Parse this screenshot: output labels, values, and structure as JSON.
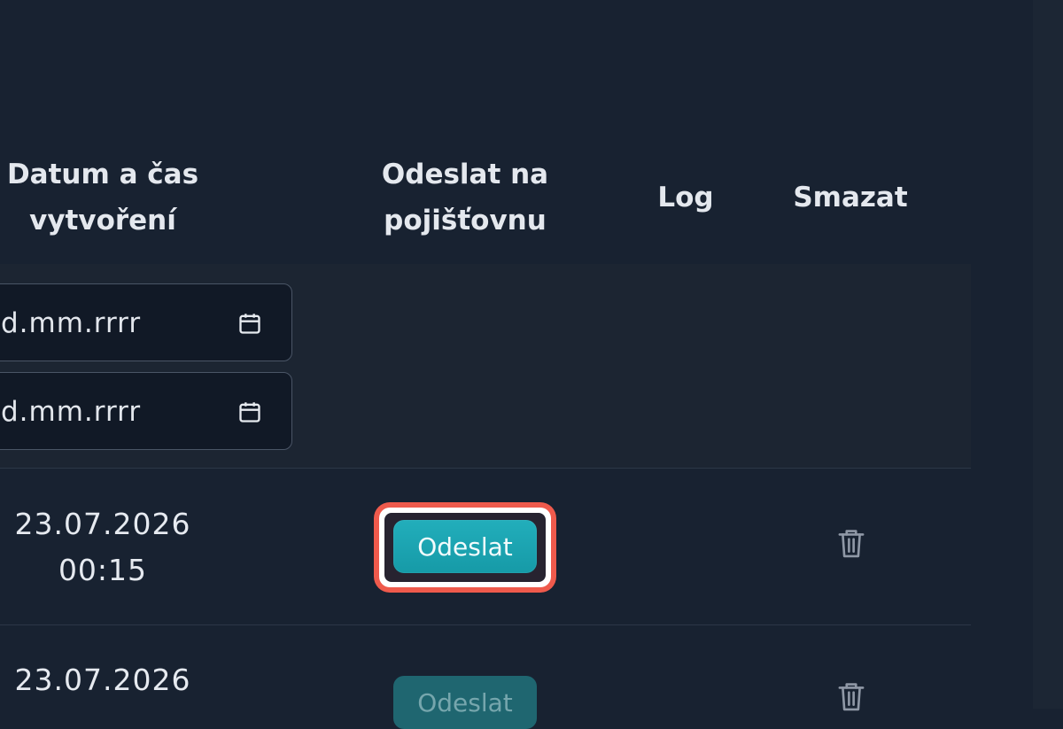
{
  "table": {
    "headers": {
      "date_created": "Datum a čas\nvytvoření",
      "send_to_insurer": "Odeslat na\npojišťovnu",
      "log": "Log",
      "delete": "Smazat"
    },
    "filters": {
      "date_from_placeholder": "d.mm.rrrr",
      "date_to_placeholder": "d.mm.rrrr",
      "icon": "calendar-icon"
    },
    "rows": [
      {
        "date": "23.07.2026",
        "time": "00:15",
        "send_label": "Odeslat",
        "send_state": "highlighted",
        "delete_icon": "trash-icon"
      },
      {
        "date": "23.07.2026",
        "send_label": "Odeslat",
        "send_state": "disabled",
        "delete_icon": "trash-icon"
      }
    ]
  },
  "colors": {
    "background": "#182231",
    "filter_row": "#1c2532",
    "input_background": "#111926",
    "accent": "#1ea7b4",
    "highlight": "#ef5a4c",
    "text": "#e4e8ee"
  }
}
